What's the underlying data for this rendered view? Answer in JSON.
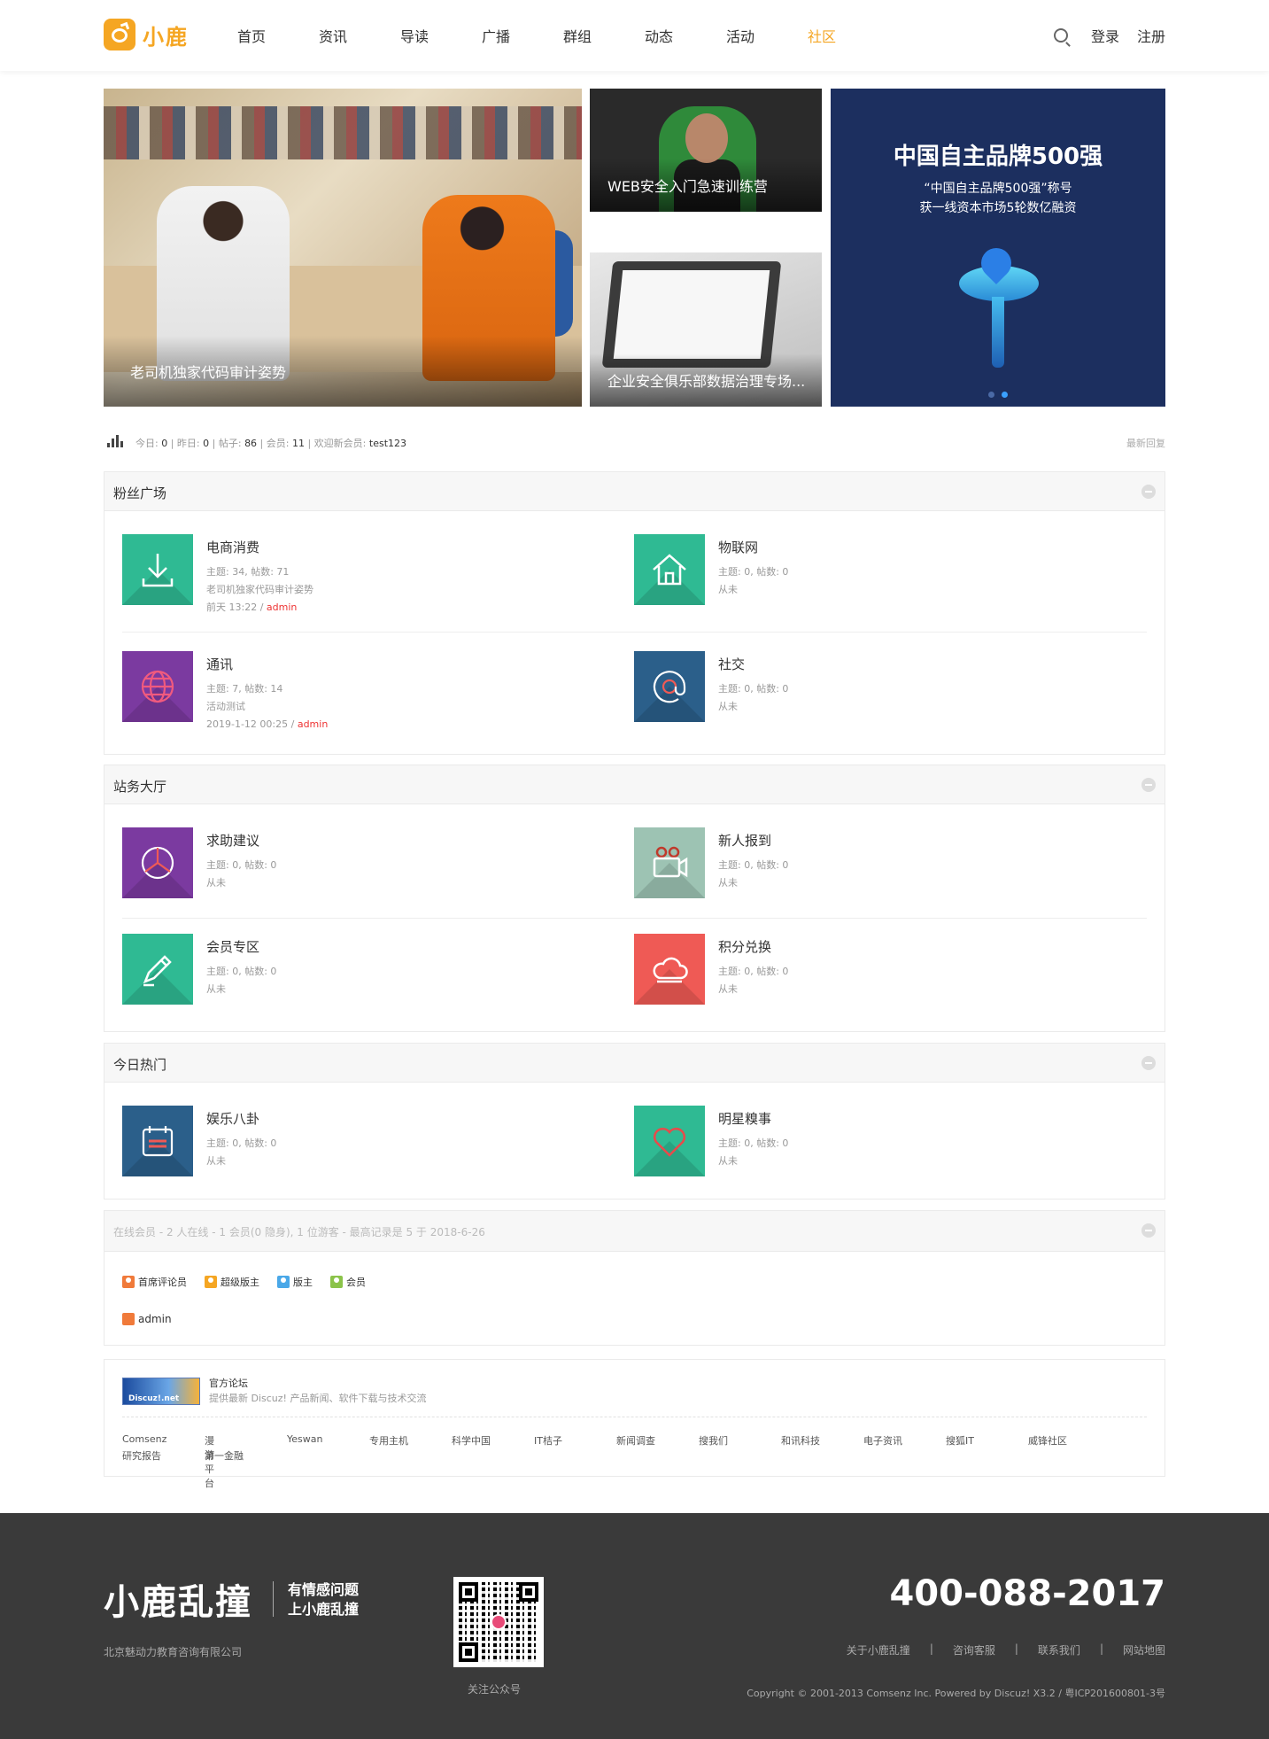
{
  "header": {
    "logo_text": "小鹿",
    "nav": [
      "首页",
      "资讯",
      "导读",
      "广播",
      "群组",
      "动态",
      "活动",
      "社区"
    ],
    "active_nav": 7,
    "login": "登录",
    "register": "注册"
  },
  "banner": {
    "main_caption": "老司机独家代码审计姿势",
    "small_top_caption": "WEB安全入门急速训练营",
    "small_bottom_caption": "企业安全俱乐部数据治理专场...",
    "ad_title": "中国自主品牌500强",
    "ad_line1": "“中国自主品牌500强”称号",
    "ad_line2": "获一线资本市场5轮数亿融资"
  },
  "stats": {
    "today_label": "今日:",
    "today": "0",
    "yesterday_label": "昨日:",
    "yesterday": "0",
    "posts_label": "帖子:",
    "posts": "86",
    "members_label": "会员:",
    "members": "11",
    "welcome_label": "欢迎新会员:",
    "newest": "test123",
    "latest_reply": "最新回复"
  },
  "sections": [
    {
      "title": "粉丝广场",
      "forums": [
        {
          "name": "电商消费",
          "stats": "主题: 34, 帖数: 71",
          "last_title": "老司机独家代码审计姿势",
          "last_time": "前天 13:22",
          "last_user": "admin",
          "color": "#2fba93",
          "icon": "download-icon"
        },
        {
          "name": "物联网",
          "stats": "主题: 0, 帖数: 0",
          "last_title": "从未",
          "last_time": "",
          "last_user": "",
          "color": "#2fba93",
          "icon": "home-icon"
        },
        {
          "name": "通讯",
          "stats": "主题: 7, 帖数: 14",
          "last_title": "活动测试",
          "last_time": "2019-1-12 00:25",
          "last_user": "admin",
          "color": "#7b3aa0",
          "icon": "globe-icon"
        },
        {
          "name": "社交",
          "stats": "主题: 0, 帖数: 0",
          "last_title": "从未",
          "last_time": "",
          "last_user": "",
          "color": "#2b5f8a",
          "icon": "at-icon"
        }
      ]
    },
    {
      "title": "站务大厅",
      "forums": [
        {
          "name": "求助建议",
          "stats": "主题: 0, 帖数: 0",
          "last_title": "从未",
          "color": "#7b3aa0",
          "icon": "aperture-icon"
        },
        {
          "name": "新人报到",
          "stats": "主题: 0, 帖数: 0",
          "last_title": "从未",
          "color": "#9dc3b3",
          "icon": "video-camera-icon"
        },
        {
          "name": "会员专区",
          "stats": "主题: 0, 帖数: 0",
          "last_title": "从未",
          "color": "#2fba93",
          "icon": "pencil-icon"
        },
        {
          "name": "积分兑换",
          "stats": "主题: 0, 帖数: 0",
          "last_title": "从未",
          "color": "#ef5a55",
          "icon": "cloud-icon"
        }
      ]
    },
    {
      "title": "今日热门",
      "forums": [
        {
          "name": "娱乐八卦",
          "stats": "主题: 0, 帖数: 0",
          "last_title": "从未",
          "color": "#2b5f8a",
          "icon": "calendar-icon"
        },
        {
          "name": "明星糗事",
          "stats": "主题: 0, 帖数: 0",
          "last_title": "从未",
          "color": "#2fba93",
          "icon": "heart-icon"
        }
      ]
    }
  ],
  "online": {
    "title": "在线会员 - 2 人在线 - 1 会员(0 隐身), 1 位游客 - 最高记录是 5 于 2018-6-26",
    "legend": [
      "首席评论员",
      "超级版主",
      "版主",
      "会员"
    ],
    "user": "admin"
  },
  "links": {
    "logo_text": "Discuz!.net",
    "title": "官方论坛",
    "desc": "提供最新 Discuz! 产品新闻、软件下载与技术交流",
    "row1": [
      "Comsenz",
      "漫游平台",
      "Yeswan",
      "专用主机",
      "科学中国",
      "IT桔子",
      "新闻调查",
      "搜我们",
      "和讯科技",
      "电子资讯",
      "搜狐IT",
      "威锋社区"
    ],
    "row2": [
      "研究报告",
      "第一金融"
    ]
  },
  "footer": {
    "brand": "小鹿乱撞",
    "slogan1": "有情感问题",
    "slogan2": "上小鹿乱撞",
    "company": "北京魅动力教育咨询有限公司",
    "qr_caption": "关注公众号",
    "phone": "400-088-2017",
    "links": [
      "关于小鹿乱撞",
      "咨询客服",
      "联系我们",
      "网站地图"
    ],
    "copyright": "Copyright © 2001-2013 Comsenz Inc.  Powered by Discuz! X3.2 / 粤ICP201600801-3号"
  }
}
